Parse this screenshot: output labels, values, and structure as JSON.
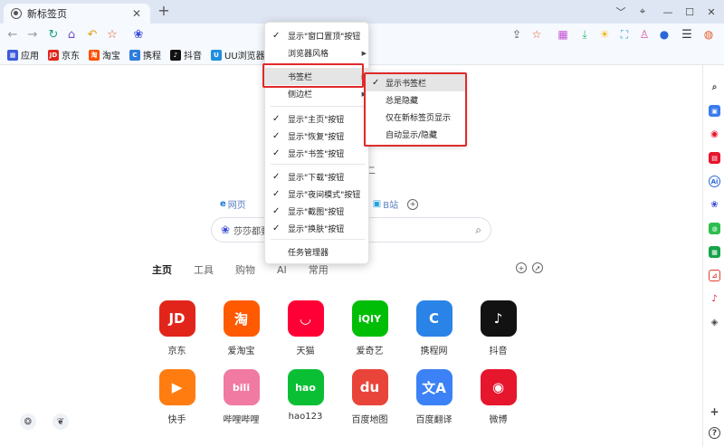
{
  "tab": {
    "title": "新标签页"
  },
  "window_controls": [
    "﹀",
    "⌖",
    "—",
    "☐",
    "✕"
  ],
  "bookmarks": [
    {
      "label": "应用",
      "icon": "apps-grid-icon",
      "color": "#3b5bdb",
      "glyph": "▦"
    },
    {
      "label": "京东",
      "icon": "jd-icon",
      "color": "#e1251b",
      "glyph": "JD"
    },
    {
      "label": "淘宝",
      "icon": "taobao-icon",
      "color": "#ff5000",
      "glyph": "淘"
    },
    {
      "label": "携程",
      "icon": "ctrip-icon",
      "color": "#2e7ddb",
      "glyph": "C"
    },
    {
      "label": "抖音",
      "icon": "douyin-icon",
      "color": "#111111",
      "glyph": "♪"
    },
    {
      "label": "UU浏览器隐私政",
      "icon": "uu-browser-icon",
      "color": "#1f8fe0",
      "glyph": "U"
    }
  ],
  "date_fragment": "二",
  "engines": [
    {
      "label": "网页"
    },
    {
      "label": "B站"
    }
  ],
  "search": {
    "placeholder": "莎莎都要"
  },
  "categories": [
    "主页",
    "工具",
    "购物",
    "AI",
    "常用"
  ],
  "sites": [
    {
      "name": "京东",
      "color": "#e1251b",
      "glyph": "JD"
    },
    {
      "name": "爱淘宝",
      "color": "#ff5a00",
      "glyph": "淘"
    },
    {
      "name": "天猫",
      "color": "#ff0036",
      "glyph": "◡"
    },
    {
      "name": "爱奇艺",
      "color": "#00be06",
      "glyph": "iQIY"
    },
    {
      "name": "携程网",
      "color": "#2a83e6",
      "glyph": "C"
    },
    {
      "name": "抖音",
      "color": "#121212",
      "glyph": "♪"
    },
    {
      "name": "快手",
      "color": "#ff7c10",
      "glyph": "▶"
    },
    {
      "name": "哔哩哔哩",
      "color": "#f07aa1",
      "glyph": "bili"
    },
    {
      "name": "hao123",
      "color": "#0bbf35",
      "glyph": "hao"
    },
    {
      "name": "百度地图",
      "color": "#e9443a",
      "glyph": "du"
    },
    {
      "name": "百度翻译",
      "color": "#3c82f6",
      "glyph": "文A"
    },
    {
      "name": "微博",
      "color": "#e6162d",
      "glyph": "◉"
    }
  ],
  "menu": {
    "items": [
      {
        "label": "显示\"窗口置顶\"按钮",
        "checked": true
      },
      {
        "label": "浏览器风格",
        "submenu": true
      },
      {
        "label": "书签栏",
        "submenu": true,
        "hover": true
      },
      {
        "label": "侧边栏",
        "submenu": true
      },
      {
        "label": "显示\"主页\"按钮",
        "checked": true
      },
      {
        "label": "显示\"恢复\"按钮",
        "checked": true
      },
      {
        "label": "显示\"书签\"按钮",
        "checked": true
      },
      {
        "label": "显示\"下载\"按钮",
        "checked": true
      },
      {
        "label": "显示\"夜间模式\"按钮",
        "checked": true
      },
      {
        "label": "显示\"截图\"按钮",
        "checked": true
      },
      {
        "label": "显示\"换肤\"按钮",
        "checked": true
      },
      {
        "label": "任务管理器"
      }
    ]
  },
  "submenu": {
    "items": [
      {
        "label": "显示书签栏",
        "checked": true,
        "hover": true
      },
      {
        "label": "总是隐藏"
      },
      {
        "label": "仅在新标签页显示"
      },
      {
        "label": "自动显示/隐藏"
      }
    ]
  },
  "colors": {
    "highlight": "#e0292b",
    "tabstrip": "#dfe6f3",
    "toolbar": "#f6f9fd"
  }
}
